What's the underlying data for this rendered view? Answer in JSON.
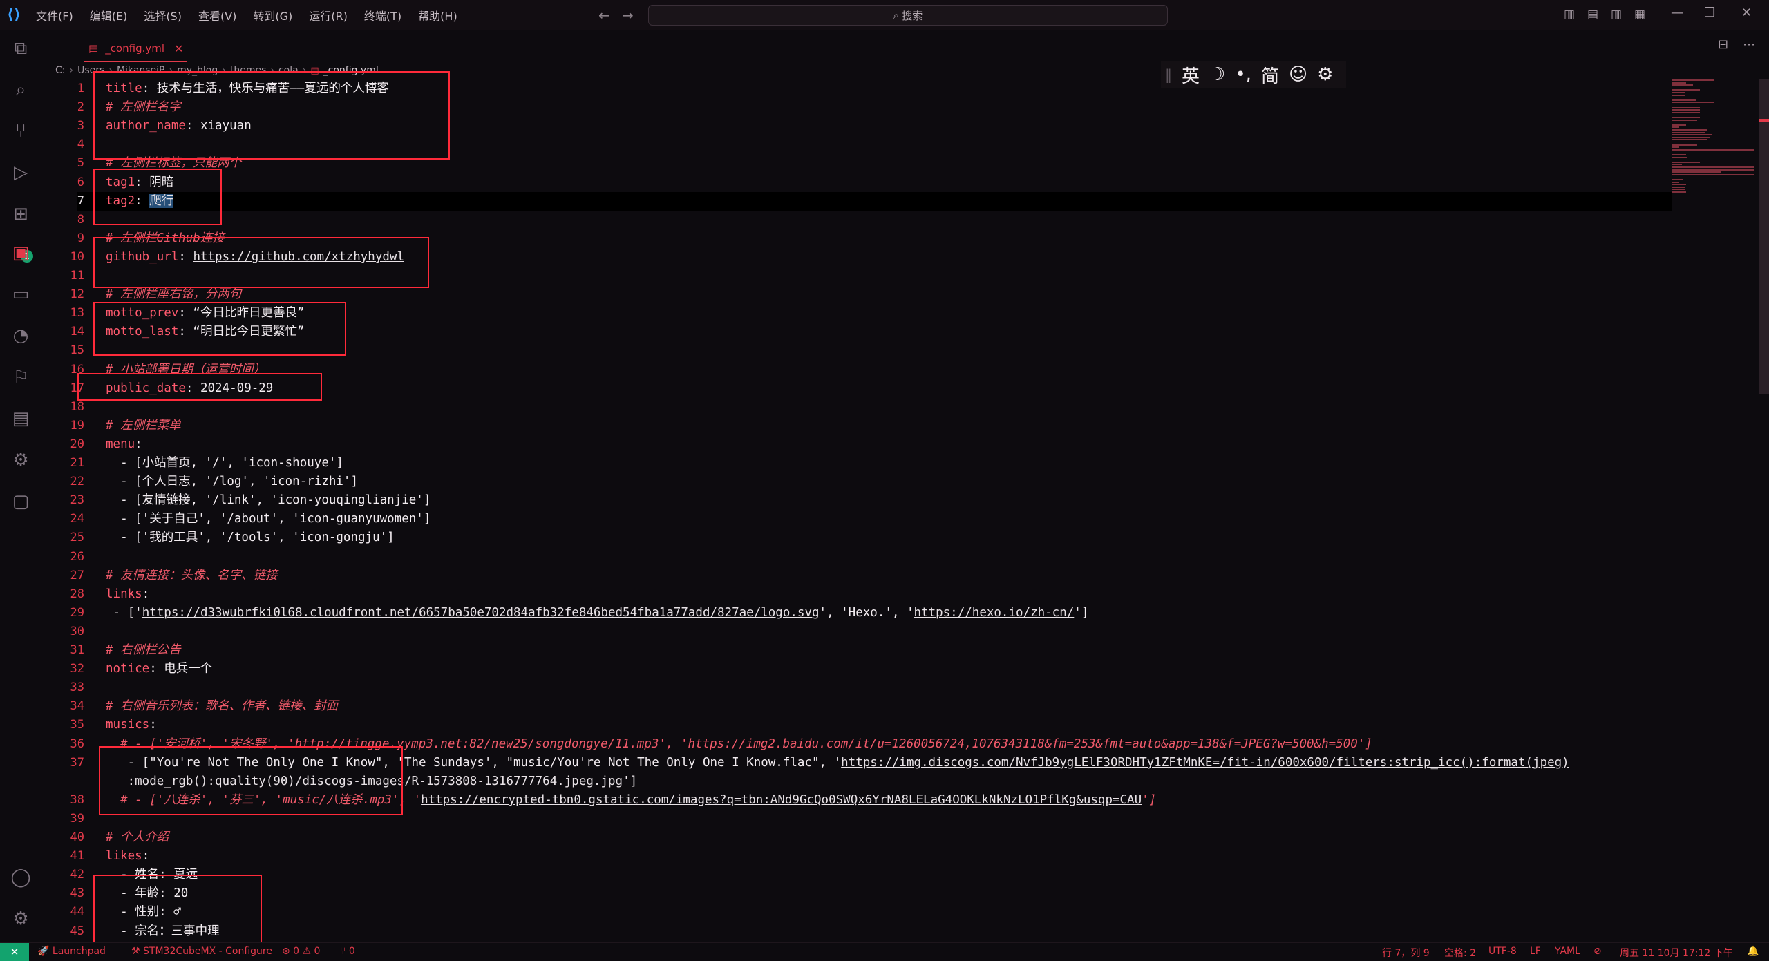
{
  "menu": [
    "文件(F)",
    "编辑(E)",
    "选择(S)",
    "查看(V)",
    "转到(G)",
    "运行(R)",
    "终端(T)",
    "帮助(H)"
  ],
  "search": {
    "placeholder": "搜索"
  },
  "tab": {
    "label": "_config.yml"
  },
  "breadcrumb": [
    "C:",
    "Users",
    "MikanseiP",
    "my_blog",
    "themes",
    "cola",
    "_config.yml"
  ],
  "ime": {
    "lang": "英",
    "moon": "☽",
    "punct": "•,",
    "simp": "简",
    "emoji": "☺",
    "settings": "⚙"
  },
  "activity_badge": "1",
  "code_lines": [
    [
      [
        "k",
        "title"
      ],
      [
        "v",
        ": 技术与生活，快乐与痛苦——夏远的个人博客"
      ]
    ],
    [
      [
        "c",
        "# 左侧栏名字"
      ]
    ],
    [
      [
        "k",
        "author_name"
      ],
      [
        "v",
        ": xiayuan"
      ]
    ],
    [],
    [
      [
        "c",
        "# 左侧栏标签，只能两个"
      ]
    ],
    [
      [
        "k",
        "tag1"
      ],
      [
        "v",
        ": 阴暗"
      ]
    ],
    [
      [
        "k",
        "tag2"
      ],
      [
        "v",
        ": "
      ],
      [
        "sel",
        "爬行"
      ]
    ],
    [],
    [
      [
        "c",
        "# 左侧栏Github连接"
      ]
    ],
    [
      [
        "k",
        "github_url"
      ],
      [
        "v",
        ": "
      ],
      [
        "u",
        "https://github.com/xtzhyhydwl"
      ]
    ],
    [],
    [
      [
        "c",
        "# 左侧栏座右铭，分两句"
      ]
    ],
    [
      [
        "k",
        "motto_prev"
      ],
      [
        "v",
        ": “今日比昨日更善良”"
      ]
    ],
    [
      [
        "k",
        "motto_last"
      ],
      [
        "v",
        ": “明日比今日更繁忙”"
      ]
    ],
    [],
    [
      [
        "c",
        "# 小站部署日期（运营时间）"
      ]
    ],
    [
      [
        "k",
        "public_date"
      ],
      [
        "v",
        ": 2024-09-29"
      ]
    ],
    [],
    [
      [
        "c",
        "# 左侧栏菜单"
      ]
    ],
    [
      [
        "k",
        "menu"
      ],
      [
        "v",
        ":"
      ]
    ],
    [
      [
        "v",
        "  - [小站首页, '/', 'icon-shouye']"
      ]
    ],
    [
      [
        "v",
        "  - [个人日志, '/log', 'icon-rizhi']"
      ]
    ],
    [
      [
        "v",
        "  - [友情链接, '/link', 'icon-youqinglianjie']"
      ]
    ],
    [
      [
        "v",
        "  - ['关于自己', '/about', 'icon-guanyuwomen']"
      ]
    ],
    [
      [
        "v",
        "  - ['我的工具', '/tools', 'icon-gongju']"
      ]
    ],
    [],
    [
      [
        "c",
        "# 友情连接：头像、名字、链接"
      ]
    ],
    [
      [
        "k",
        "links"
      ],
      [
        "v",
        ":"
      ]
    ],
    [
      [
        "v",
        " - ['"
      ],
      [
        "u",
        "https://d33wubrfki0l68.cloudfront.net/6657ba50e702d84afb32fe846bed54fba1a77add/827ae/logo.svg"
      ],
      [
        "v",
        "', 'Hexo.', '"
      ],
      [
        "u",
        "https://hexo.io/zh-cn/"
      ],
      [
        "v",
        "']"
      ]
    ],
    [],
    [
      [
        "c",
        "# 右侧栏公告"
      ]
    ],
    [
      [
        "k",
        "notice"
      ],
      [
        "v",
        ": 电兵一个"
      ]
    ],
    [],
    [
      [
        "c",
        "# 右侧音乐列表：歌名、作者、链接、封面"
      ]
    ],
    [
      [
        "k",
        "musics"
      ],
      [
        "v",
        ":"
      ]
    ],
    [
      [
        "c",
        "  # - ['安河桥', '宋冬野', 'http://tingge.yymp3.net:82/new25/songdongye/11.mp3', 'https://img2.baidu.com/it/u=1260056724,1076343118&fm=253&fmt=auto&app=138&f=JPEG?w=500&h=500']"
      ]
    ],
    [
      [
        "v",
        "   - [\"You're Not The Only One I Know\", 'The Sundays', \"music/You're Not The Only One I Know.flac\", '"
      ],
      [
        "u",
        "https://img.discogs.com/NvfJb9ygLElF3ORDHTy1ZFtMnKE=/fit-in/600x600/filters:strip_icc():format(jpeg)"
      ]
    ],
    [
      [
        "v",
        "   "
      ],
      [
        "u",
        ":mode_rgb():quality(90)/discogs-images/R-1573808-1316777764.jpeg.jpg"
      ],
      [
        "v",
        "']"
      ]
    ],
    [
      [
        "c",
        "  # - ['八连杀', '芬三', 'music/八连杀.mp3', '"
      ],
      [
        "u",
        "https://encrypted-tbn0.gstatic.com/images?q=tbn:ANd9GcQo0SWQx6YrNA8LELaG4OOKLkNkNzLO1PflKg&usqp=CAU"
      ],
      [
        "c",
        "']"
      ]
    ],
    [],
    [
      [
        "c",
        "# 个人介绍"
      ]
    ],
    [
      [
        "k",
        "likes"
      ],
      [
        "v",
        ":"
      ]
    ],
    [
      [
        "v",
        "  - 姓名: 夏远"
      ]
    ],
    [
      [
        "v",
        "  - 年龄: 20"
      ]
    ],
    [
      [
        "v",
        "  - 性别: ♂"
      ]
    ],
    [
      [
        "v",
        "  - 宗名：三事中理"
      ]
    ]
  ],
  "line_numbers": [
    "1",
    "2",
    "3",
    "4",
    "5",
    "6",
    "7",
    "8",
    "9",
    "10",
    "11",
    "12",
    "13",
    "14",
    "15",
    "16",
    "17",
    "18",
    "19",
    "20",
    "21",
    "22",
    "23",
    "24",
    "25",
    "26",
    "27",
    "28",
    "29",
    "30",
    "31",
    "32",
    "33",
    "34",
    "35",
    "36",
    "37",
    "",
    "38",
    "39",
    "40",
    "41",
    "42",
    "43",
    "44",
    "45"
  ],
  "status": {
    "remote": "✕",
    "launchpad": "Launchpad",
    "stm": "STM32CubeMX - Configure",
    "problems": "⊗ 0 ⚠ 0",
    "ports": "⑂ 0",
    "position": "行 7，列 9",
    "spaces": "空格: 2",
    "encoding": "UTF-8",
    "eol": "LF",
    "lang": "YAML",
    "notify": "⊘",
    "datetime": "周五 11 10月 17:12 下午",
    "bell": "🔔"
  },
  "colors": {
    "accent": "#e23a4a",
    "remote": "#13a36e",
    "background": "#0d0b0f"
  }
}
